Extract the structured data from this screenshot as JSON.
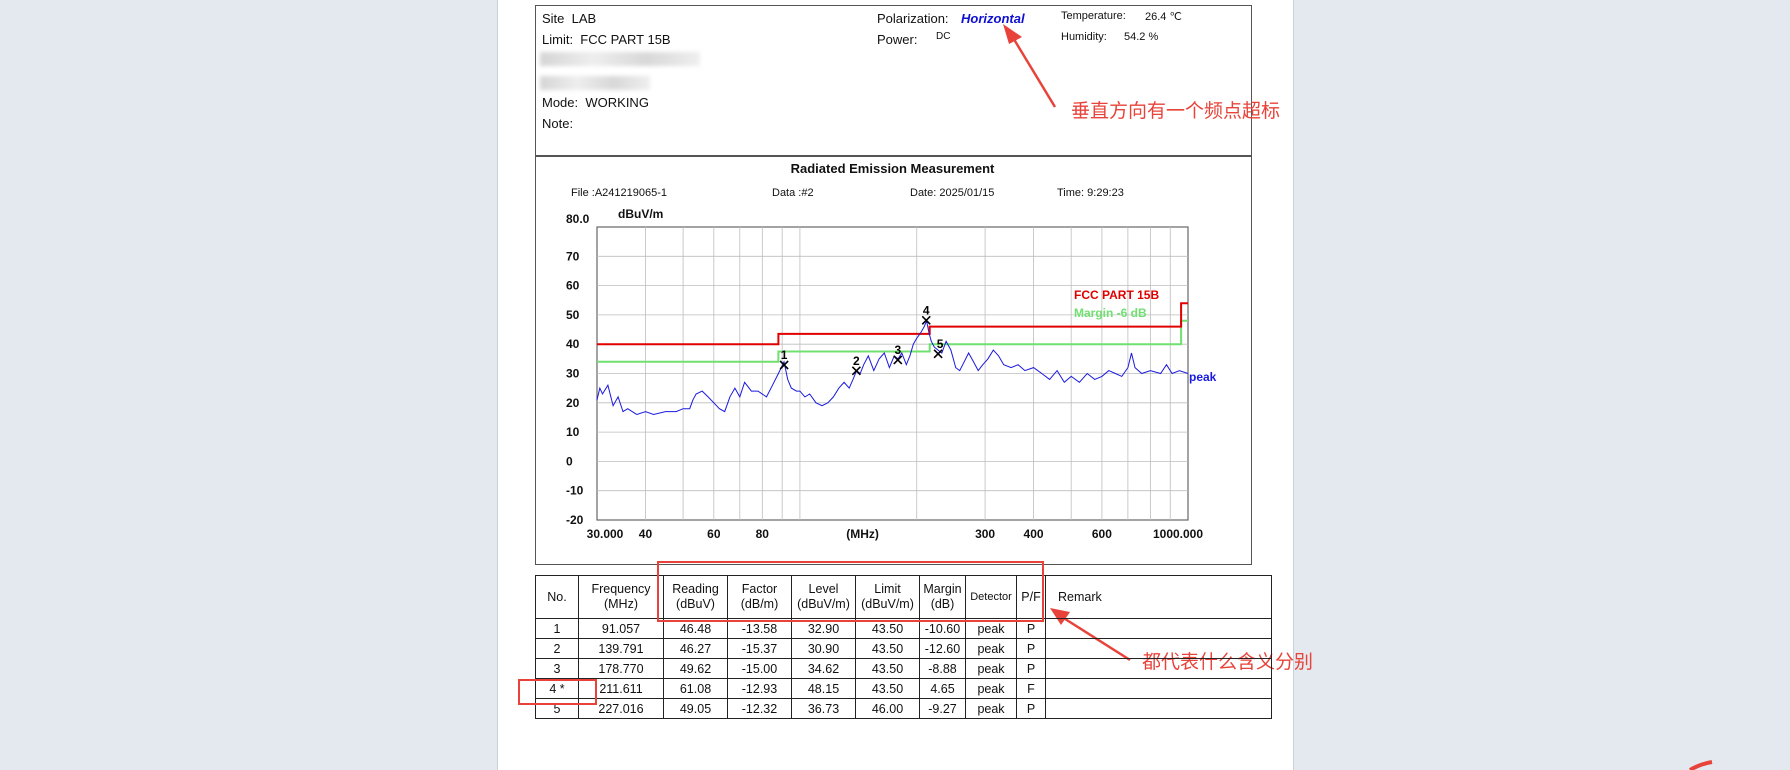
{
  "header": {
    "site_label": "Site",
    "site_value": "LAB",
    "limit_label": "Limit:",
    "limit_value": "FCC PART 15B",
    "mode_label": "Mode:",
    "mode_value": "WORKING",
    "note_label": "Note:",
    "polarization_label": "Polarization:",
    "polarization_value": "Horizontal",
    "power_label": "Power:",
    "power_value": "DC",
    "temperature_label": "Temperature:",
    "temperature_value": "26.4 ℃",
    "humidity_label": "Humidity:",
    "humidity_value": "54.2 %"
  },
  "annotations": {
    "vertical_note": "垂直方向有一个频点超标",
    "columns_note": "都代表什么含义分别"
  },
  "meta": {
    "title": "Radiated Emission Measurement",
    "file": "File :A241219065-1",
    "data": "Data :#2",
    "date": "Date: 2025/01/15",
    "time": "Time: 9:29:23"
  },
  "chart_data": {
    "type": "line",
    "title": "Radiated Emission Measurement",
    "ylabel": "dBuV/m",
    "xlabel": "(MHz)",
    "x_scale": "log",
    "xlim": [
      30,
      1000
    ],
    "ylim": [
      -20,
      80
    ],
    "y_ticks": [
      "80.0",
      "70",
      "60",
      "50",
      "40",
      "30",
      "20",
      "10",
      "0",
      "-10",
      "-20"
    ],
    "x_ticks": [
      "30.000",
      "40",
      "60",
      "80",
      "(MHz)",
      "300",
      "400",
      "600",
      "1000.000"
    ],
    "grid": true,
    "limit_line": {
      "name": "FCC PART 15B",
      "color": "#e00000",
      "points": [
        [
          30,
          40
        ],
        [
          88,
          40
        ],
        [
          88,
          43.5
        ],
        [
          216,
          43.5
        ],
        [
          216,
          46
        ],
        [
          960,
          46
        ],
        [
          960,
          54
        ],
        [
          1000,
          54
        ]
      ]
    },
    "margin_line": {
      "name": "Margin -6 dB",
      "color": "#70e070",
      "points": [
        [
          30,
          34
        ],
        [
          88,
          34
        ],
        [
          88,
          37.5
        ],
        [
          216,
          37.5
        ],
        [
          216,
          40
        ],
        [
          960,
          40
        ],
        [
          960,
          48
        ],
        [
          1000,
          48
        ]
      ]
    },
    "trace": {
      "name": "peak",
      "color": "#1a1ae0",
      "points": [
        [
          30,
          21
        ],
        [
          30.5,
          25
        ],
        [
          31,
          23
        ],
        [
          32,
          26
        ],
        [
          33,
          19
        ],
        [
          34,
          22
        ],
        [
          35,
          17
        ],
        [
          36,
          18
        ],
        [
          38,
          16
        ],
        [
          40,
          17
        ],
        [
          42,
          16
        ],
        [
          45,
          17
        ],
        [
          48,
          17
        ],
        [
          50,
          18
        ],
        [
          52,
          18
        ],
        [
          53,
          21
        ],
        [
          54,
          23
        ],
        [
          56,
          24
        ],
        [
          58,
          22
        ],
        [
          60,
          20
        ],
        [
          62,
          18
        ],
        [
          64,
          17
        ],
        [
          66,
          22
        ],
        [
          68,
          25
        ],
        [
          70,
          22
        ],
        [
          72,
          27
        ],
        [
          75,
          24
        ],
        [
          78,
          24
        ],
        [
          82,
          22
        ],
        [
          85,
          26
        ],
        [
          88,
          30
        ],
        [
          91,
          34
        ],
        [
          93,
          28
        ],
        [
          95,
          25
        ],
        [
          98,
          24
        ],
        [
          100,
          24
        ],
        [
          103,
          22
        ],
        [
          106,
          23
        ],
        [
          110,
          20
        ],
        [
          114,
          19
        ],
        [
          118,
          20
        ],
        [
          122,
          22
        ],
        [
          126,
          25
        ],
        [
          130,
          27
        ],
        [
          134,
          25
        ],
        [
          137,
          28
        ],
        [
          140,
          31
        ],
        [
          143,
          30
        ],
        [
          146,
          33
        ],
        [
          150,
          36
        ],
        [
          155,
          31
        ],
        [
          160,
          35
        ],
        [
          165,
          37
        ],
        [
          170,
          32
        ],
        [
          175,
          36
        ],
        [
          179,
          35
        ],
        [
          183,
          37
        ],
        [
          188,
          33
        ],
        [
          192,
          36
        ],
        [
          196,
          40
        ],
        [
          200,
          42
        ],
        [
          205,
          44
        ],
        [
          209,
          46
        ],
        [
          212,
          48
        ],
        [
          215,
          44
        ],
        [
          218,
          41
        ],
        [
          222,
          39
        ],
        [
          227,
          38
        ],
        [
          232,
          37
        ],
        [
          238,
          41
        ],
        [
          245,
          38
        ],
        [
          252,
          32
        ],
        [
          258,
          31
        ],
        [
          265,
          34
        ],
        [
          272,
          37
        ],
        [
          280,
          34
        ],
        [
          288,
          31
        ],
        [
          296,
          33
        ],
        [
          305,
          35
        ],
        [
          315,
          38
        ],
        [
          325,
          36
        ],
        [
          335,
          33
        ],
        [
          350,
          32
        ],
        [
          365,
          33
        ],
        [
          380,
          31
        ],
        [
          400,
          32
        ],
        [
          420,
          30
        ],
        [
          440,
          28
        ],
        [
          460,
          31
        ],
        [
          480,
          27
        ],
        [
          500,
          29
        ],
        [
          525,
          27
        ],
        [
          550,
          30
        ],
        [
          575,
          28
        ],
        [
          600,
          29
        ],
        [
          625,
          31
        ],
        [
          650,
          30
        ],
        [
          675,
          29
        ],
        [
          700,
          32
        ],
        [
          715,
          37
        ],
        [
          730,
          32
        ],
        [
          760,
          30
        ],
        [
          800,
          31
        ],
        [
          850,
          30
        ],
        [
          880,
          33
        ],
        [
          910,
          30
        ],
        [
          950,
          31
        ],
        [
          1000,
          30
        ]
      ]
    },
    "markers": [
      {
        "label": "1",
        "x": 91.057,
        "y": 32.9
      },
      {
        "label": "2",
        "x": 139.791,
        "y": 30.9
      },
      {
        "label": "3",
        "x": 178.77,
        "y": 34.62
      },
      {
        "label": "4",
        "x": 211.611,
        "y": 48.15
      },
      {
        "label": "5",
        "x": 227.016,
        "y": 36.73
      }
    ]
  },
  "table": {
    "headers": [
      [
        "No."
      ],
      [
        "Frequency",
        "(MHz)"
      ],
      [
        "Reading",
        "(dBuV)"
      ],
      [
        "Factor",
        "(dB/m)"
      ],
      [
        "Level",
        "(dBuV/m)"
      ],
      [
        "Limit",
        "(dBuV/m)"
      ],
      [
        "Margin",
        "(dB)"
      ],
      [
        "Detector"
      ],
      [
        "P/F"
      ],
      [
        "Remark"
      ]
    ],
    "rows": [
      [
        "1",
        "91.057",
        "46.48",
        "-13.58",
        "32.90",
        "43.50",
        "-10.60",
        "peak",
        "P",
        ""
      ],
      [
        "2",
        "139.791",
        "46.27",
        "-15.37",
        "30.90",
        "43.50",
        "-12.60",
        "peak",
        "P",
        ""
      ],
      [
        "3",
        "178.770",
        "49.62",
        "-15.00",
        "34.62",
        "43.50",
        "-8.88",
        "peak",
        "P",
        ""
      ],
      [
        "4 *",
        "211.611",
        "61.08",
        "-12.93",
        "48.15",
        "43.50",
        "4.65",
        "peak",
        "F",
        ""
      ],
      [
        "5",
        "227.016",
        "49.05",
        "-12.32",
        "36.73",
        "46.00",
        "-9.27",
        "peak",
        "P",
        ""
      ]
    ]
  }
}
